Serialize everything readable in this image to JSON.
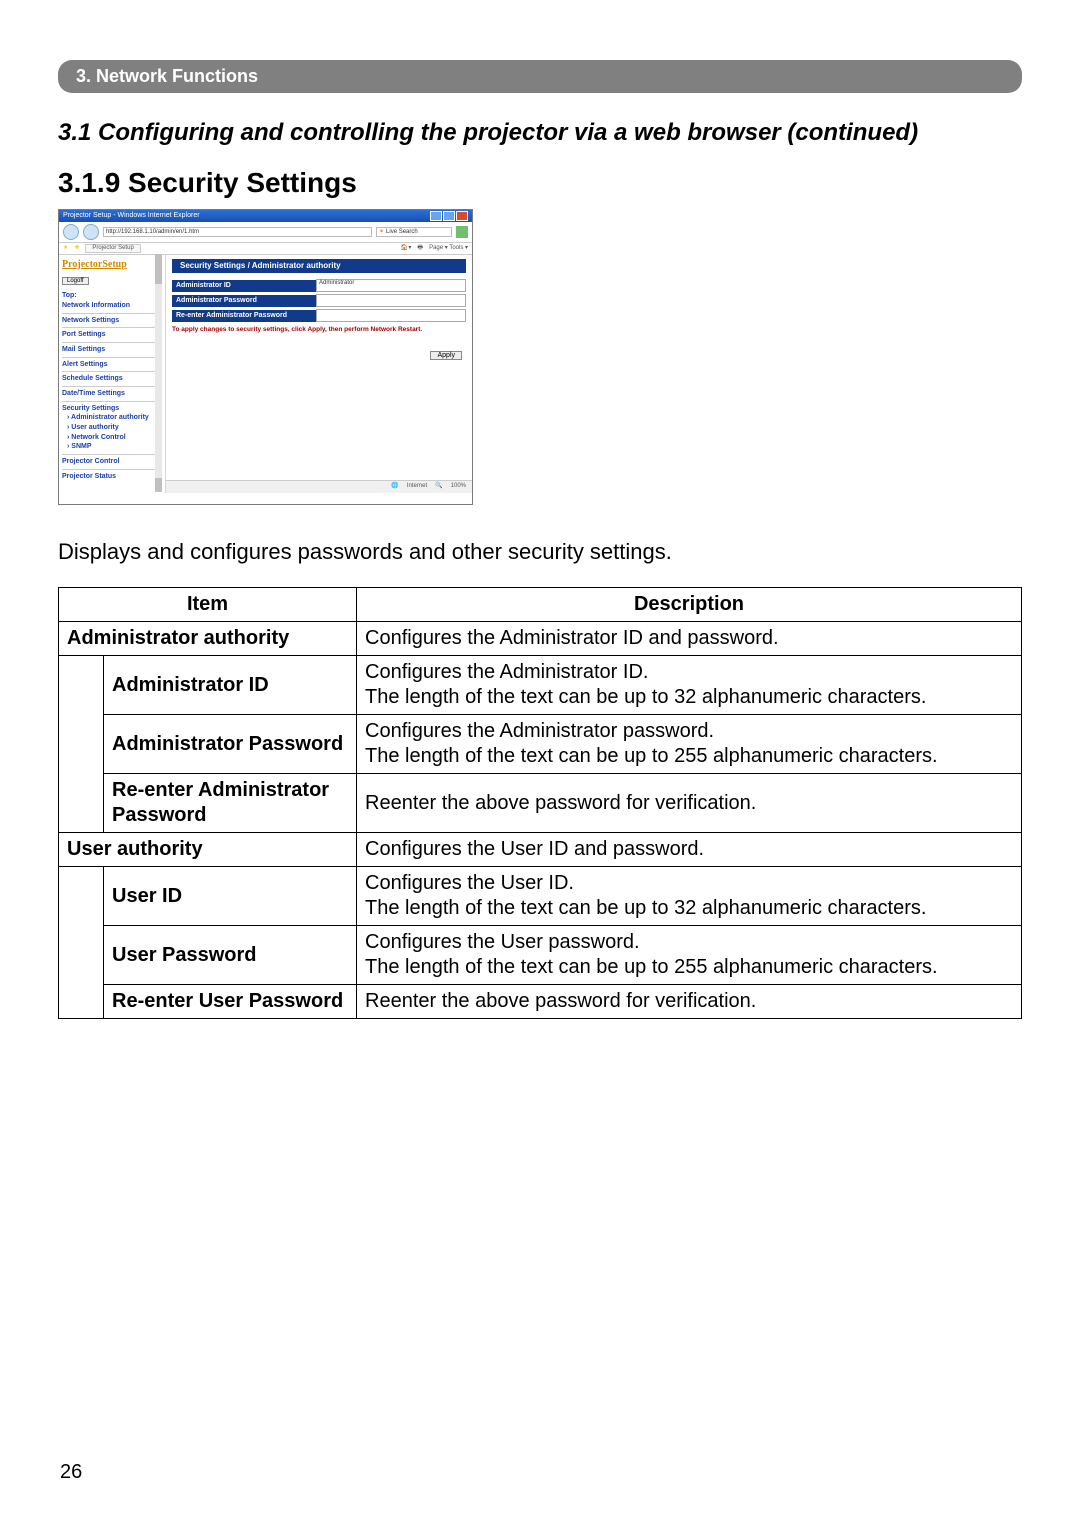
{
  "chapter_bar": "3. Network Functions",
  "section_title": "3.1 Configuring and controlling the projector via a web browser (continued)",
  "subsection_title": "3.1.9 Security Settings",
  "intro_text": "Displays and configures passwords and other security settings.",
  "page_number": "26",
  "screenshot": {
    "window_title": "Projector Setup - Windows Internet Explorer",
    "url": "http://192.168.1.10/admin/en/1.htm",
    "search_placeholder": "Live Search",
    "tab_label": "Projector Setup",
    "toolbar_right": "Page ▾  Tools ▾",
    "status_internet": "Internet",
    "status_zoom": "100%",
    "sidebar": {
      "logo": "ProjectorSetup",
      "logoff_btn": "Logoff",
      "links": [
        "Top:",
        "Network Information",
        "Network Settings",
        "Port Settings",
        "Mail Settings",
        "Alert Settings",
        "Schedule Settings",
        "Date/Time Settings",
        "Security Settings",
        "Projector Control",
        "Projector Status"
      ],
      "sub_links": [
        "Administrator authority",
        "User authority",
        "Network Control",
        "SNMP"
      ]
    },
    "main": {
      "breadcrumb": "Security Settings / Administrator authority",
      "rows": [
        {
          "label": "Administrator ID",
          "value": "Administrator"
        },
        {
          "label": "Administrator Password",
          "value": ""
        },
        {
          "label": "Re-enter Administrator Password",
          "value": ""
        }
      ],
      "note": "To apply changes to security settings, click Apply, then perform Network Restart.",
      "apply_btn": "Apply"
    }
  },
  "table": {
    "headers": {
      "item": "Item",
      "description": "Description"
    },
    "rows": [
      {
        "indent": false,
        "item": "Administrator authority",
        "desc": "Configures the Administrator ID and password."
      },
      {
        "indent": true,
        "item": "Administrator ID",
        "desc": "Configures the Administrator ID.\nThe length of the text can be up to 32 alphanumeric characters."
      },
      {
        "indent": true,
        "item": "Administrator Password",
        "desc": "Configures the Administrator password.\nThe length of the text can be up to 255 alphanumeric characters."
      },
      {
        "indent": true,
        "item": "Re-enter Administrator Password",
        "desc": "Reenter the above password for verification."
      },
      {
        "indent": false,
        "item": "User authority",
        "desc": "Configures the User ID and password."
      },
      {
        "indent": true,
        "item": "User ID",
        "desc": "Configures the User ID.\nThe length of the text can be up to 32 alphanumeric characters."
      },
      {
        "indent": true,
        "item": "User Password",
        "desc": "Configures the User password.\nThe length of the text can be up to 255 alphanumeric characters."
      },
      {
        "indent": true,
        "item": "Re-enter User Password",
        "desc": "Reenter the above password for verification."
      }
    ]
  }
}
